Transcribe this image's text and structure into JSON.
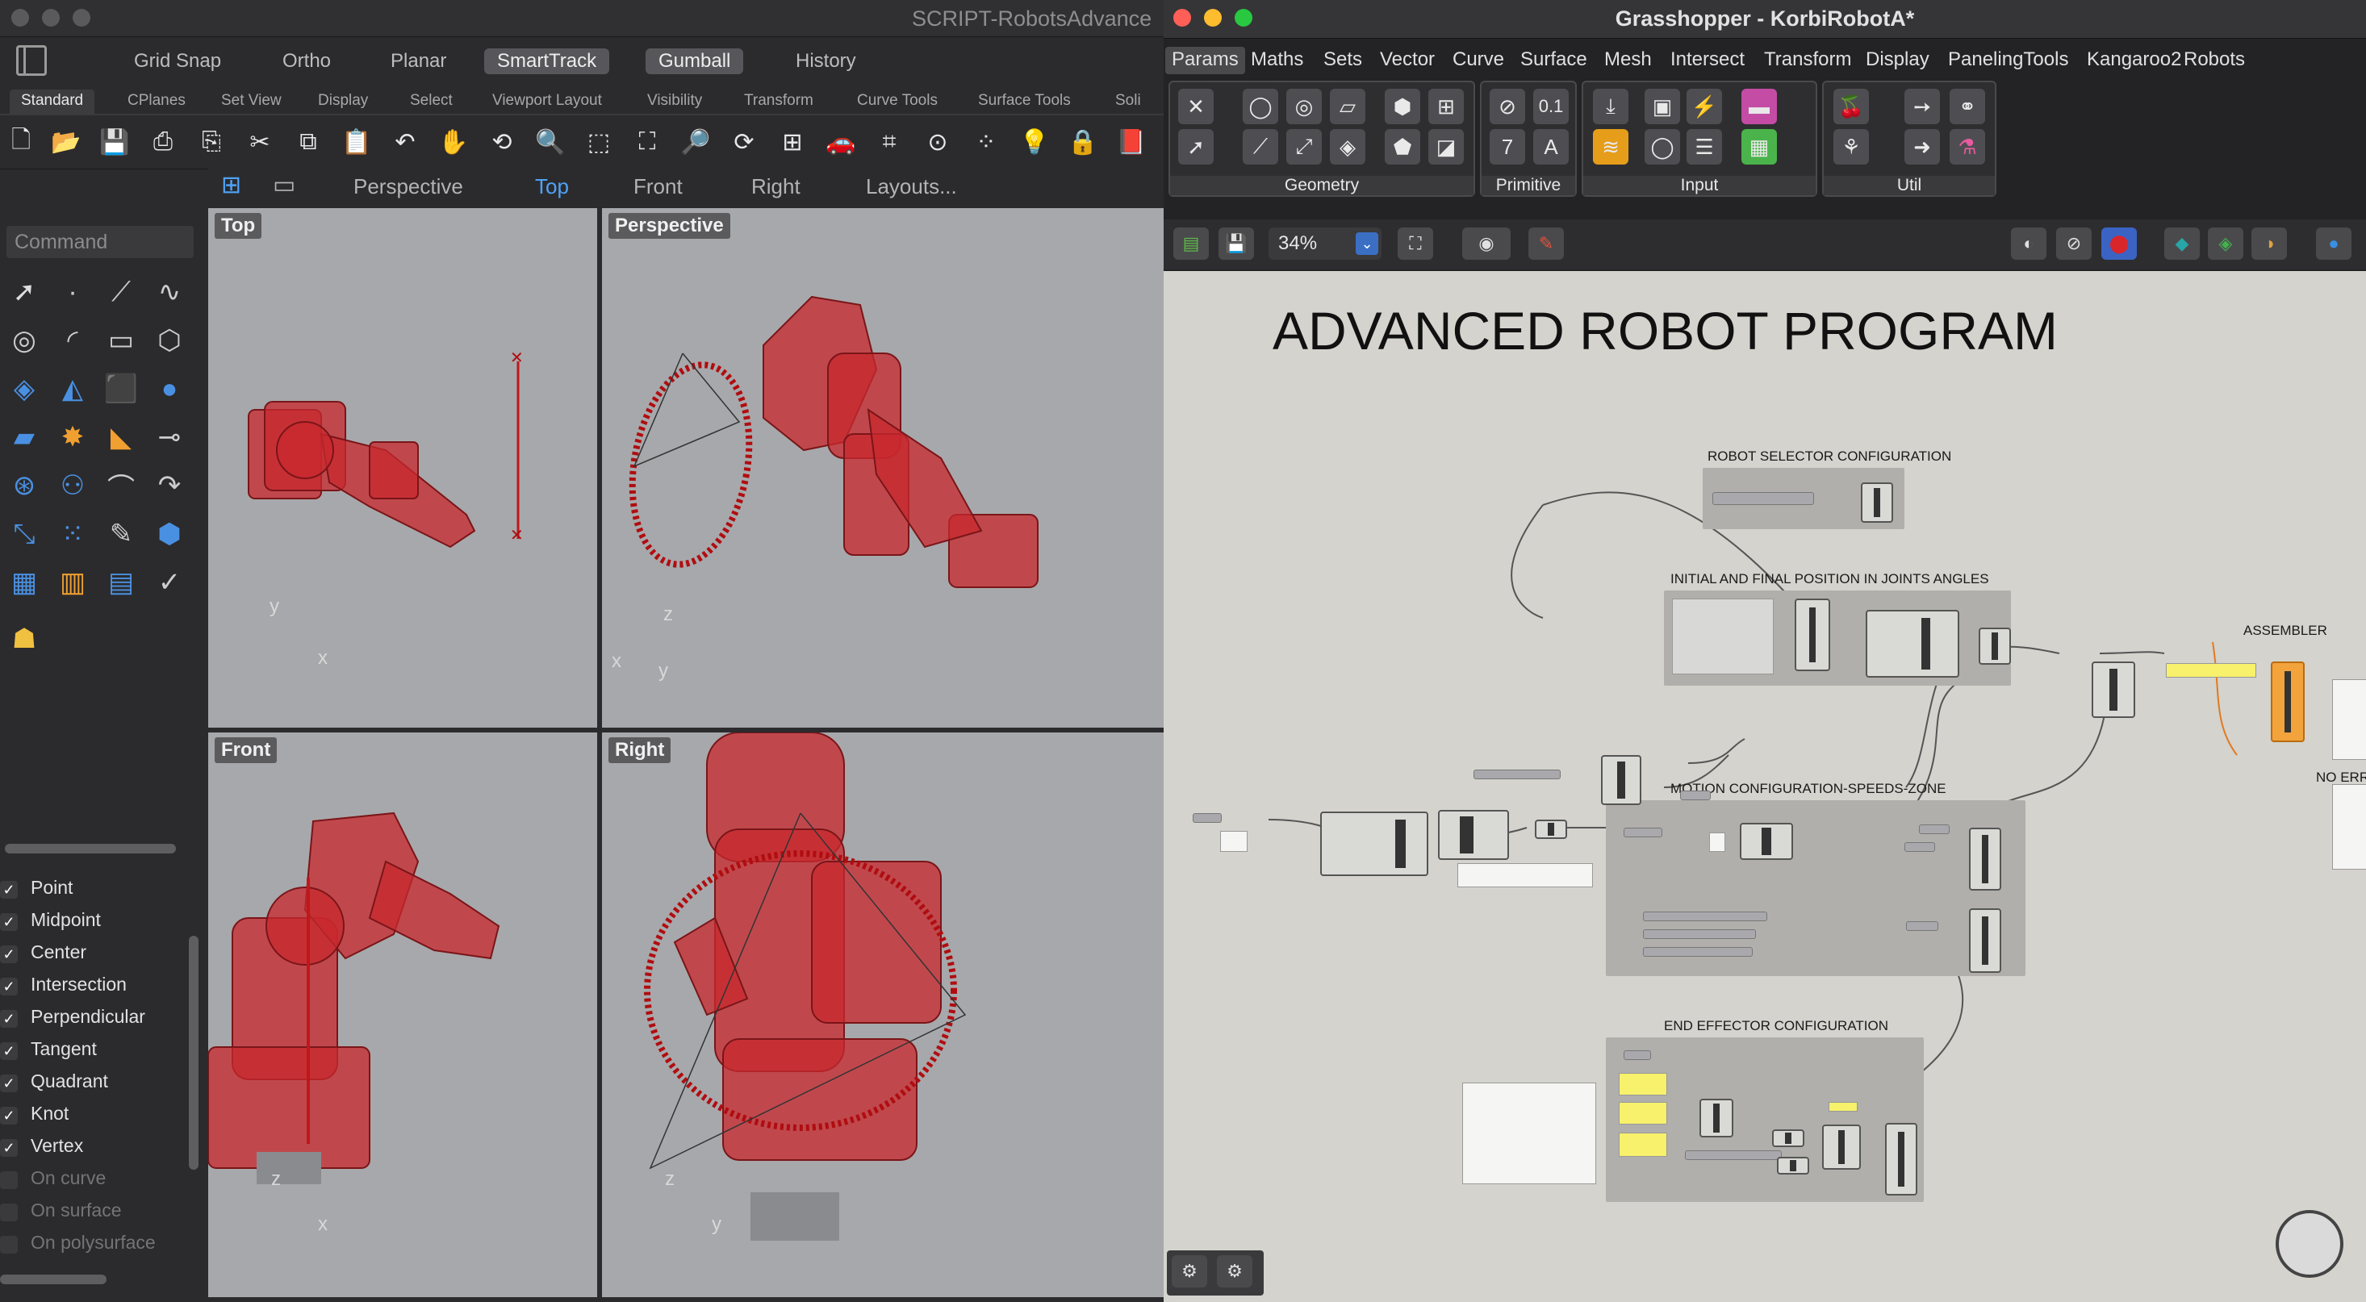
{
  "rhino": {
    "title": "SCRIPT-RobotsAdvance",
    "osnap_bar": [
      "Grid Snap",
      "Ortho",
      "Planar",
      "SmartTrack",
      "Gumball",
      "History"
    ],
    "tabs": [
      "Standard",
      "CPlanes",
      "Set View",
      "Display",
      "Select",
      "Viewport Layout",
      "Visibility",
      "Transform",
      "Curve Tools",
      "Surface Tools",
      "Soli"
    ],
    "view_tabs": [
      "Perspective",
      "Top",
      "Front",
      "Right",
      "Layouts..."
    ],
    "active_view_tab": "Top",
    "command_placeholder": "Command",
    "viewports": {
      "top": "Top",
      "perspective": "Perspective",
      "front": "Front",
      "right": "Right"
    },
    "osnaps": [
      {
        "label": "Point",
        "on": true
      },
      {
        "label": "Midpoint",
        "on": true
      },
      {
        "label": "Center",
        "on": true
      },
      {
        "label": "Intersection",
        "on": true
      },
      {
        "label": "Perpendicular",
        "on": true
      },
      {
        "label": "Tangent",
        "on": true
      },
      {
        "label": "Quadrant",
        "on": true
      },
      {
        "label": "Knot",
        "on": true
      },
      {
        "label": "Vertex",
        "on": true
      },
      {
        "label": "On curve",
        "on": false
      },
      {
        "label": "On surface",
        "on": false
      },
      {
        "label": "On polysurface",
        "on": false
      }
    ],
    "axes": {
      "x": "x",
      "y": "y",
      "z": "z"
    }
  },
  "grasshopper": {
    "title": "Grasshopper - KorbiRobotA*",
    "tabs": [
      "Params",
      "Maths",
      "Sets",
      "Vector",
      "Curve",
      "Surface",
      "Mesh",
      "Intersect",
      "Transform",
      "Display",
      "PanelingTools",
      "Kangaroo2",
      "Robots"
    ],
    "active_tab": "Params",
    "groups": [
      "Geometry",
      "Primitive",
      "Input",
      "Util"
    ],
    "primitive_labels": [
      "0.1",
      "7",
      "A"
    ],
    "zoom": "34%",
    "canvas_title": "ADVANCED ROBOT PROGRAM",
    "group_labels": {
      "robot_selector": "ROBOT SELECTOR CONFIGURATION",
      "initial_final": "INITIAL AND FINAL POSITION IN JOINTS ANGLES",
      "motion": "MOTION CONFIGURATION-SPEEDS-ZONE",
      "end_effector": "END EFFECTOR CONFIGURATION",
      "assembler": "ASSEMBLER",
      "no_err": "NO ERR"
    }
  },
  "colors": {
    "accent": "#4fa3f7",
    "robot": "#c8282d",
    "canvas": "#d4d3cd"
  }
}
